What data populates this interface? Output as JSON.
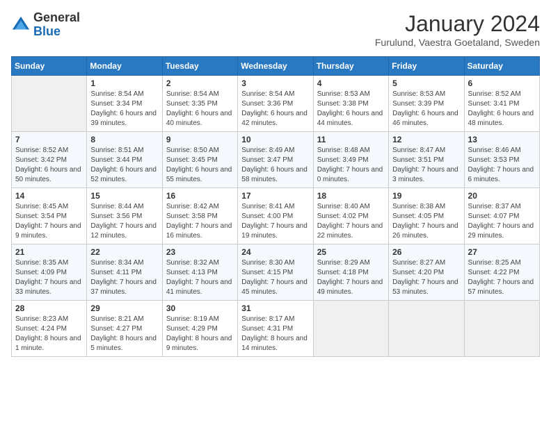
{
  "logo": {
    "general": "General",
    "blue": "Blue"
  },
  "header": {
    "title": "January 2024",
    "subtitle": "Furulund, Vaestra Goetaland, Sweden"
  },
  "weekdays": [
    "Sunday",
    "Monday",
    "Tuesday",
    "Wednesday",
    "Thursday",
    "Friday",
    "Saturday"
  ],
  "weeks": [
    [
      {
        "day": "",
        "sunrise": "",
        "sunset": "",
        "daylight": ""
      },
      {
        "day": "1",
        "sunrise": "Sunrise: 8:54 AM",
        "sunset": "Sunset: 3:34 PM",
        "daylight": "Daylight: 6 hours and 39 minutes."
      },
      {
        "day": "2",
        "sunrise": "Sunrise: 8:54 AM",
        "sunset": "Sunset: 3:35 PM",
        "daylight": "Daylight: 6 hours and 40 minutes."
      },
      {
        "day": "3",
        "sunrise": "Sunrise: 8:54 AM",
        "sunset": "Sunset: 3:36 PM",
        "daylight": "Daylight: 6 hours and 42 minutes."
      },
      {
        "day": "4",
        "sunrise": "Sunrise: 8:53 AM",
        "sunset": "Sunset: 3:38 PM",
        "daylight": "Daylight: 6 hours and 44 minutes."
      },
      {
        "day": "5",
        "sunrise": "Sunrise: 8:53 AM",
        "sunset": "Sunset: 3:39 PM",
        "daylight": "Daylight: 6 hours and 46 minutes."
      },
      {
        "day": "6",
        "sunrise": "Sunrise: 8:52 AM",
        "sunset": "Sunset: 3:41 PM",
        "daylight": "Daylight: 6 hours and 48 minutes."
      }
    ],
    [
      {
        "day": "7",
        "sunrise": "Sunrise: 8:52 AM",
        "sunset": "Sunset: 3:42 PM",
        "daylight": "Daylight: 6 hours and 50 minutes."
      },
      {
        "day": "8",
        "sunrise": "Sunrise: 8:51 AM",
        "sunset": "Sunset: 3:44 PM",
        "daylight": "Daylight: 6 hours and 52 minutes."
      },
      {
        "day": "9",
        "sunrise": "Sunrise: 8:50 AM",
        "sunset": "Sunset: 3:45 PM",
        "daylight": "Daylight: 6 hours and 55 minutes."
      },
      {
        "day": "10",
        "sunrise": "Sunrise: 8:49 AM",
        "sunset": "Sunset: 3:47 PM",
        "daylight": "Daylight: 6 hours and 58 minutes."
      },
      {
        "day": "11",
        "sunrise": "Sunrise: 8:48 AM",
        "sunset": "Sunset: 3:49 PM",
        "daylight": "Daylight: 7 hours and 0 minutes."
      },
      {
        "day": "12",
        "sunrise": "Sunrise: 8:47 AM",
        "sunset": "Sunset: 3:51 PM",
        "daylight": "Daylight: 7 hours and 3 minutes."
      },
      {
        "day": "13",
        "sunrise": "Sunrise: 8:46 AM",
        "sunset": "Sunset: 3:53 PM",
        "daylight": "Daylight: 7 hours and 6 minutes."
      }
    ],
    [
      {
        "day": "14",
        "sunrise": "Sunrise: 8:45 AM",
        "sunset": "Sunset: 3:54 PM",
        "daylight": "Daylight: 7 hours and 9 minutes."
      },
      {
        "day": "15",
        "sunrise": "Sunrise: 8:44 AM",
        "sunset": "Sunset: 3:56 PM",
        "daylight": "Daylight: 7 hours and 12 minutes."
      },
      {
        "day": "16",
        "sunrise": "Sunrise: 8:42 AM",
        "sunset": "Sunset: 3:58 PM",
        "daylight": "Daylight: 7 hours and 16 minutes."
      },
      {
        "day": "17",
        "sunrise": "Sunrise: 8:41 AM",
        "sunset": "Sunset: 4:00 PM",
        "daylight": "Daylight: 7 hours and 19 minutes."
      },
      {
        "day": "18",
        "sunrise": "Sunrise: 8:40 AM",
        "sunset": "Sunset: 4:02 PM",
        "daylight": "Daylight: 7 hours and 22 minutes."
      },
      {
        "day": "19",
        "sunrise": "Sunrise: 8:38 AM",
        "sunset": "Sunset: 4:05 PM",
        "daylight": "Daylight: 7 hours and 26 minutes."
      },
      {
        "day": "20",
        "sunrise": "Sunrise: 8:37 AM",
        "sunset": "Sunset: 4:07 PM",
        "daylight": "Daylight: 7 hours and 29 minutes."
      }
    ],
    [
      {
        "day": "21",
        "sunrise": "Sunrise: 8:35 AM",
        "sunset": "Sunset: 4:09 PM",
        "daylight": "Daylight: 7 hours and 33 minutes."
      },
      {
        "day": "22",
        "sunrise": "Sunrise: 8:34 AM",
        "sunset": "Sunset: 4:11 PM",
        "daylight": "Daylight: 7 hours and 37 minutes."
      },
      {
        "day": "23",
        "sunrise": "Sunrise: 8:32 AM",
        "sunset": "Sunset: 4:13 PM",
        "daylight": "Daylight: 7 hours and 41 minutes."
      },
      {
        "day": "24",
        "sunrise": "Sunrise: 8:30 AM",
        "sunset": "Sunset: 4:15 PM",
        "daylight": "Daylight: 7 hours and 45 minutes."
      },
      {
        "day": "25",
        "sunrise": "Sunrise: 8:29 AM",
        "sunset": "Sunset: 4:18 PM",
        "daylight": "Daylight: 7 hours and 49 minutes."
      },
      {
        "day": "26",
        "sunrise": "Sunrise: 8:27 AM",
        "sunset": "Sunset: 4:20 PM",
        "daylight": "Daylight: 7 hours and 53 minutes."
      },
      {
        "day": "27",
        "sunrise": "Sunrise: 8:25 AM",
        "sunset": "Sunset: 4:22 PM",
        "daylight": "Daylight: 7 hours and 57 minutes."
      }
    ],
    [
      {
        "day": "28",
        "sunrise": "Sunrise: 8:23 AM",
        "sunset": "Sunset: 4:24 PM",
        "daylight": "Daylight: 8 hours and 1 minute."
      },
      {
        "day": "29",
        "sunrise": "Sunrise: 8:21 AM",
        "sunset": "Sunset: 4:27 PM",
        "daylight": "Daylight: 8 hours and 5 minutes."
      },
      {
        "day": "30",
        "sunrise": "Sunrise: 8:19 AM",
        "sunset": "Sunset: 4:29 PM",
        "daylight": "Daylight: 8 hours and 9 minutes."
      },
      {
        "day": "31",
        "sunrise": "Sunrise: 8:17 AM",
        "sunset": "Sunset: 4:31 PM",
        "daylight": "Daylight: 8 hours and 14 minutes."
      },
      {
        "day": "",
        "sunrise": "",
        "sunset": "",
        "daylight": ""
      },
      {
        "day": "",
        "sunrise": "",
        "sunset": "",
        "daylight": ""
      },
      {
        "day": "",
        "sunrise": "",
        "sunset": "",
        "daylight": ""
      }
    ]
  ]
}
